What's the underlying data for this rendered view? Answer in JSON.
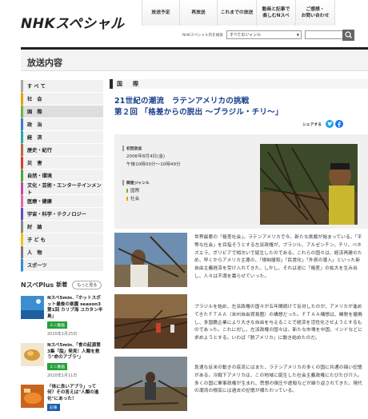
{
  "header": {
    "logo_text": "NHKスペシャル",
    "nav": [
      {
        "label": "放送予定"
      },
      {
        "label": "再放送"
      },
      {
        "label": "これまでの放送"
      },
      {
        "label": "動画と記事で\n楽しむNスペ"
      },
      {
        "label": "ご感想・\nお問い合わせ"
      }
    ],
    "search_label": "NHKスペシャル内を検索",
    "genre_select_value": "すべてのジャンル"
  },
  "page_title": "放送内容",
  "sidebar": {
    "categories": [
      {
        "label": "す べ て",
        "color": "#aaaaaa"
      },
      {
        "label": "社　会",
        "color": "#e8a200"
      },
      {
        "label": "国　際",
        "color": "#6db33f"
      },
      {
        "label": "政　治",
        "color": "#3a7bd5"
      },
      {
        "label": "経　済",
        "color": "#2aa6a0"
      },
      {
        "label": "歴史・紀行",
        "color": "#b36b3f"
      },
      {
        "label": "災　害",
        "color": "#d93c3c"
      },
      {
        "label": "自然・環境",
        "color": "#45a845"
      },
      {
        "label": "文化・芸術・エンターテインメント",
        "color": "#c24aa6"
      },
      {
        "label": "医療・健康",
        "color": "#e26aa0"
      },
      {
        "label": "宇宙・科学・テクノロジー",
        "color": "#5a4fc4"
      },
      {
        "label": "討　論",
        "color": "#888888"
      },
      {
        "label": "子 ど も",
        "color": "#f0c419"
      },
      {
        "label": "人　物",
        "color": "#7a7a7a"
      },
      {
        "label": "スポーツ",
        "color": "#2c8fd6"
      }
    ],
    "nplus": {
      "logo": "NスペPlus",
      "new_label": "新着",
      "more_label": "もっと見る",
      "items": [
        {
          "title": "Nスペ5min.「ホットスポット最後の楽園 season3 第1回 カリブ海 ユカタン半島」",
          "tag": "ミニ動画",
          "date": "2020年1月25日"
        },
        {
          "title": "Nスペ5min.「食の起源第3集「脂」発見！人類を救う\"命のアブラ\"」",
          "tag": "ミニ動画",
          "date": "2020年1月11日"
        },
        {
          "title": "「体に良いアブラ」って何？その答えは\"人類の進化\"にあった！",
          "tag": "記事",
          "date": ""
        }
      ]
    }
  },
  "main": {
    "section_label": "国　際",
    "title_line1": "21世紀の潮流　ラテンアメリカの挑戦",
    "title_line2": "第２回 「格差からの脱出 〜ブラジル・チリ〜」",
    "share_label": "シェアする",
    "info": {
      "broadcast_label": "初回放送",
      "broadcast_date": "2006年8月4日(金)",
      "broadcast_time": "午後10時00分～10時49分",
      "genre_label": "関連ジャンル",
      "genres": [
        "国際",
        "社会"
      ]
    },
    "paragraphs": [
      "世界最悪の「格差社会」。ラテンアメリカで今、新たな挑戦が始まっている。「平等な社会」を目指そうとする左派政権が、ブラジル、アルゼンチン、チリ、ベネズエラ、ボリビアで相次いで誕生したのである。これらの国々は、経済再建のため、早くからアメリカ主導の、「規制緩和」「民営化」「外資の導入」といった新自由主義経済を受け入れてきた。しかし、それは逆に「格差」の拡大を生み出し、人々は不満を募らせていった。",
      "ブラジルを始め、左派政権の国々が五年間続けて反対したのが、アメリカが進めてきたＦＴＡＡ（米州自由貿易圏）の構想だった。ＦＴＡＡ構想は、関税を撤廃し、多国籍企業により大きな自由を与えることで経済を活性化させようとするものであった。これに対し、左派政権の国々は、新たな市場を中国、インドなどに求めようとする。いわば「脱アメリカ」に動き始めたのだ。",
      "急速な反米の動きの底流にはまた、ラテンアメリカの多くの国に共通の揺い記憶がある。冷戦下アメリカは、この地域に誕生した社会主義政権にたびたび介入。多くの国に軍事政権が生まれ、思想の弾圧や虐殺などが繰り返されてきた。現代の潮流の根底には過去の記憶が横たわっている。"
    ]
  }
}
